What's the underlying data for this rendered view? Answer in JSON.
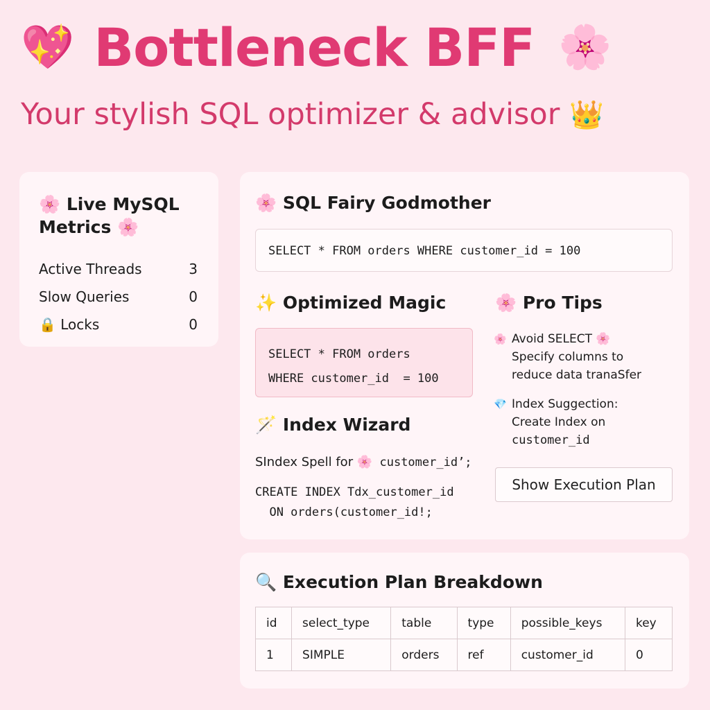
{
  "header": {
    "left_emoji": "💖",
    "title": "Bottleneck BFF",
    "right_emoji": "🌸",
    "subtitle": "Your stylish SQL optimizer & advisor",
    "subtitle_emoji": "👑"
  },
  "metrics": {
    "title_emoji": "🌸",
    "title": "Live MySQL Metrics",
    "title_emoji_end": "🌸",
    "rows": [
      {
        "label": "Active Threads",
        "value": "3"
      },
      {
        "label": "Slow Queries",
        "value": "0"
      },
      {
        "label": "🔒 Locks",
        "value": "0"
      }
    ]
  },
  "godmother": {
    "emoji": "🌸",
    "title": "SQL Fairy Godmother",
    "query": "SELECT * FROM orders WHERE customer_id = 100"
  },
  "optimized": {
    "emoji": "✨",
    "title": "Optimized Magic",
    "line1": "SELECT * FROM orders",
    "line2": "WHERE customer_id  = 100"
  },
  "wizard": {
    "emoji": "🪄",
    "title": "Index Wizard",
    "spell_prefix": "SIndex Spell for ",
    "spell_emoji": "🌸",
    "spell_suffix": " customer_id’;",
    "code1": "CREATE INDEX Tdx_customer_id",
    "code2": "  ON orders(customer_id!;"
  },
  "tips": {
    "emoji": "🌸",
    "title": "Pro Tips",
    "items": [
      {
        "icon": "🌸",
        "text_a": "Avoid SELECT",
        "text_b": "Specify columns to",
        "text_c": "reduce data tranaSfer"
      },
      {
        "icon": "💎",
        "text_a": "Index Suggection:",
        "text_b": "Create Index on",
        "text_c": "customer_id"
      }
    ],
    "tip1_end_emoji": "🌸",
    "button": "Show Execution Plan"
  },
  "plan": {
    "emoji": "🔍",
    "title": "Execution Plan Breakdown",
    "columns": [
      "id",
      "select_type",
      "table",
      "type",
      "possible_keys",
      "key"
    ],
    "row": [
      "1",
      "SIMPLE",
      "orders",
      "ref",
      "customer_id",
      "0"
    ]
  },
  "colors": {
    "background": "#fde8ee",
    "title": "#e03a73",
    "subtitle": "#d33a6b",
    "card": "#fff5f8"
  }
}
